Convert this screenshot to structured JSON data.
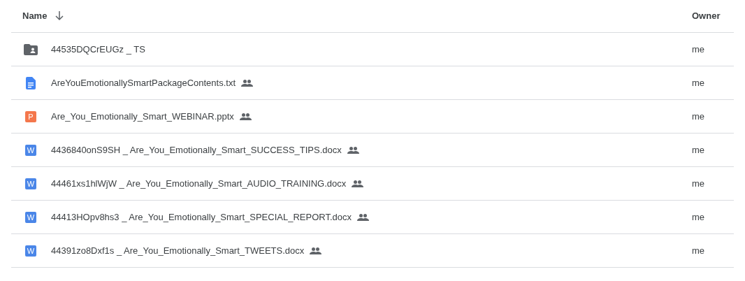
{
  "table": {
    "columns": [
      {
        "label": "Name",
        "sorted": true
      },
      {
        "label": "Owner",
        "sorted": false
      }
    ],
    "rows": [
      {
        "kind": "shared-folder",
        "name": "44535DQCrEUGz _ TS",
        "shared": false,
        "owner": "me"
      },
      {
        "kind": "text",
        "name": "AreYouEmotionallySmartPackageContents.txt",
        "shared": true,
        "owner": "me"
      },
      {
        "kind": "slides",
        "badge": "P",
        "name": "Are_You_Emotionally_Smart_WEBINAR.pptx",
        "shared": true,
        "owner": "me"
      },
      {
        "kind": "word",
        "badge": "W",
        "name": "4436840onS9SH _ Are_You_Emotionally_Smart_SUCCESS_TIPS.docx",
        "shared": true,
        "owner": "me"
      },
      {
        "kind": "word",
        "badge": "W",
        "name": "44461xs1hlWjW _ Are_You_Emotionally_Smart_AUDIO_TRAINING.docx",
        "shared": true,
        "owner": "me"
      },
      {
        "kind": "word",
        "badge": "W",
        "name": "44413HOpv8hs3 _ Are_You_Emotionally_Smart_SPECIAL_REPORT.docx",
        "shared": true,
        "owner": "me"
      },
      {
        "kind": "word",
        "badge": "W",
        "name": "44391zo8Dxf1s _ Are_You_Emotionally_Smart_TWEETS.docx",
        "shared": true,
        "owner": "me"
      }
    ]
  }
}
